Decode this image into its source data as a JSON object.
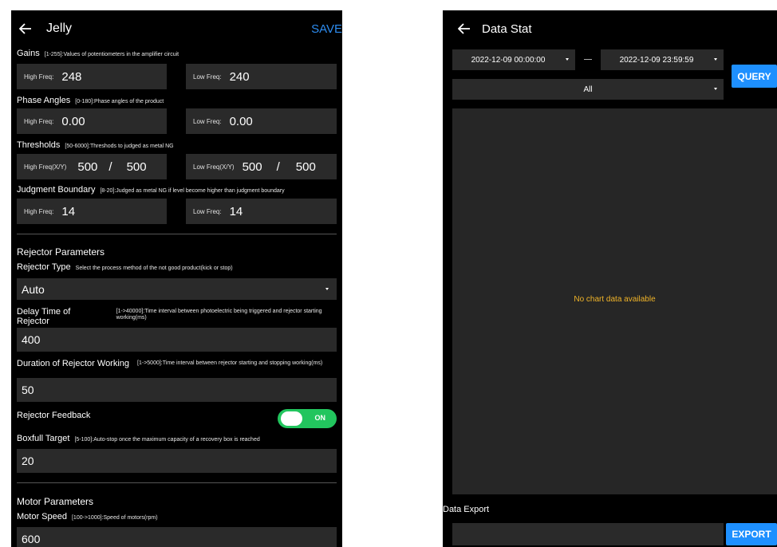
{
  "left": {
    "title": "Jelly",
    "save_label": "SAVE",
    "gains": {
      "label": "Gains",
      "hint": "[1-255]:Values of potentiometers in the amplifier circuit",
      "high_label": "High Freq:",
      "high_value": "248",
      "low_label": "Low Freq:",
      "low_value": "240"
    },
    "phase": {
      "label": "Phase Angles",
      "hint": "[0-180]:Phase angles of the product",
      "high_label": "High Freq:",
      "high_value": "0.00",
      "low_label": "Low Freq:",
      "low_value": "0.00"
    },
    "thresholds": {
      "label": "Thresholds",
      "hint": "[50-6000]:Threshods to judged as metal NG",
      "high_label": "High Freq(X/Y)",
      "high_x": "500",
      "high_y": "500",
      "sep": "/",
      "low_label": "Low Freq(X/Y)",
      "low_x": "500",
      "low_y": "500"
    },
    "boundary": {
      "label": "Judgment Boundary",
      "hint": "[8-20]:Judged as metal NG if level become higher than judgment boundary",
      "high_label": "High Freq:",
      "high_value": "14",
      "low_label": "Low Freq:",
      "low_value": "14"
    },
    "rejector": {
      "heading": "Rejector Parameters",
      "type_label": "Rejector Type",
      "type_hint": "Select the process method of the not good product(kick or stop)",
      "type_value": "Auto",
      "delay_label": "Delay Time of Rejector",
      "delay_hint": "[1->40000]:Time interval between photoelectric being triggered and rejector starting working(ms)",
      "delay_value": "400",
      "duration_label": "Duration of Rejector Working",
      "duration_hint": "[1->5000]:Time interval between rejector starting and stopping working(ms)",
      "duration_value": "50",
      "feedback_label": "Rejector Feedback",
      "feedback_state": "ON",
      "boxfull_label": "Boxfull Target",
      "boxfull_hint": "[5-100]:Auto-stop once the maximum capacity of a recovery box is reached",
      "boxfull_value": "20"
    },
    "motor": {
      "heading": "Motor Parameters",
      "speed_label": "Motor Speed",
      "speed_hint": "[100->1000]:Speed of motors(rpm)",
      "speed_value": "600"
    }
  },
  "right": {
    "title": "Data Stat",
    "start_datetime": "2022-12-09 00:00:00",
    "end_datetime": "2022-12-09 23:59:59",
    "query_label": "QUERY",
    "filter_value": "All",
    "no_data": "No chart data available",
    "export_section": "Data Export",
    "export_label": "EXPORT"
  },
  "colors": {
    "accent": "#1e90ff",
    "toggle_on": "#22c55e",
    "warning_text": "#f0b429",
    "field_bg": "#2a2a2a"
  }
}
